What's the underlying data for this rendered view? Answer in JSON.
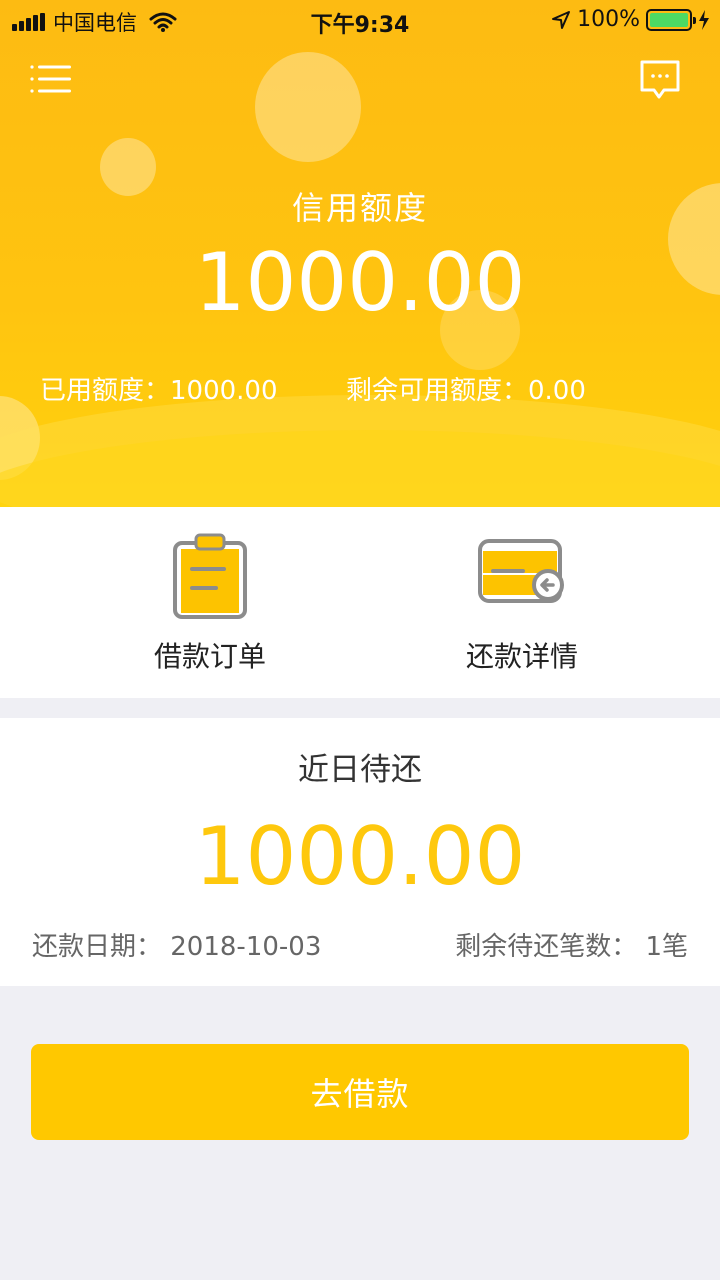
{
  "status_bar": {
    "carrier": "中国电信",
    "time": "下午9:34",
    "battery": "100%"
  },
  "header": {
    "menu_icon": "list-menu-icon",
    "message_icon": "chat-bubble-icon"
  },
  "credit": {
    "title": "信用额度",
    "amount": "1000.00",
    "used_text": "已用额度：1000.00",
    "remaining_text": "剩余可用额度：0.00"
  },
  "actions": [
    {
      "label": "借款订单",
      "icon": "clipboard-order-icon"
    },
    {
      "label": "还款详情",
      "icon": "card-repay-icon"
    }
  ],
  "upcoming": {
    "title": "近日待还",
    "amount": "1000.00",
    "date_text": "还款日期：  2018-10-03",
    "count_text": "剩余待还笔数：  1笔"
  },
  "borrow_button": {
    "label": "去借款"
  },
  "colors": {
    "brand_yellow": "#ffc800",
    "amount_yellow": "#fec80d",
    "battery_green": "#4cd964"
  }
}
